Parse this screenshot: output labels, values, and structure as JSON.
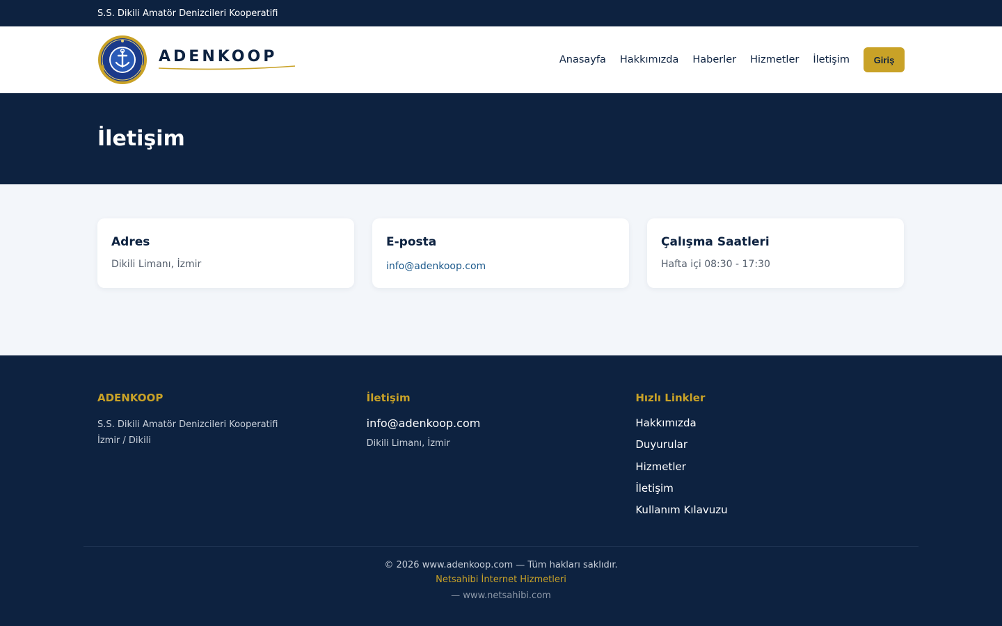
{
  "topbar": {
    "org_name": "S.S. Dikili Amatör Denizcileri Kooperatifi"
  },
  "header": {
    "brand_name": "ADENKOOP",
    "nav": [
      {
        "label": "Anasayfa"
      },
      {
        "label": "Hakkımızda"
      },
      {
        "label": "Haberler"
      },
      {
        "label": "Hizmetler"
      },
      {
        "label": "İletişim"
      }
    ],
    "login_label": "Giriş"
  },
  "hero": {
    "title": "İletişim"
  },
  "cards": [
    {
      "title": "Adres",
      "value": "Dikili Limanı, İzmir"
    },
    {
      "title": "E-posta",
      "value": "info@adenkoop.com"
    },
    {
      "title": "Çalışma Saatleri",
      "value": "Hafta içi 08:30 - 17:30"
    }
  ],
  "footer": {
    "about": {
      "heading": "ADENKOOP",
      "line1": "S.S. Dikili Amatör Denizcileri Kooperatifi",
      "line2": "İzmir / Dikili"
    },
    "contact": {
      "heading": "İletişim",
      "email": "info@adenkoop.com",
      "address": "Dikili Limanı, İzmir"
    },
    "links": {
      "heading": "Hızlı Linkler",
      "items": [
        {
          "label": "Hakkımızda"
        },
        {
          "label": "Duyurular"
        },
        {
          "label": "Hizmetler"
        },
        {
          "label": "İletişim"
        },
        {
          "label": "Kullanım Kılavuzu"
        }
      ]
    },
    "copyright": "© 2026 www.adenkoop.com — Tüm hakları saklıdır.",
    "credit": "Netsahibi İnternet Hizmetleri",
    "credit_url": "— www.netsahibi.com"
  },
  "colors": {
    "navy": "#0d2240",
    "gold": "#c9a227",
    "background": "#f3f6fa"
  },
  "icons": {
    "logo": "cooperative-seal-anchor-icon"
  }
}
